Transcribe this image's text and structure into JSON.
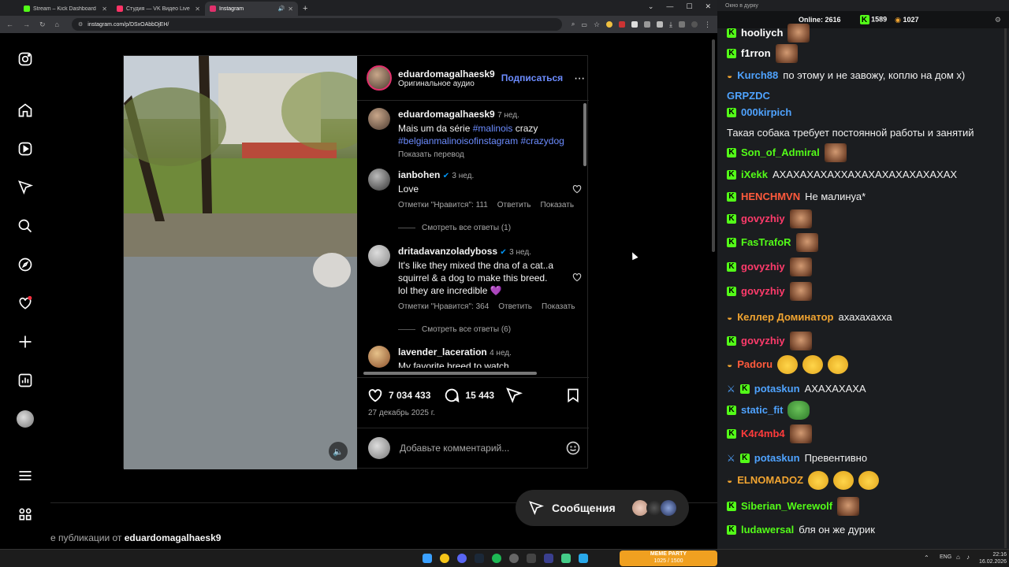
{
  "browser": {
    "tabs": [
      {
        "title": "Stream – Kick Dashboard",
        "color": "#53fc18",
        "active": false
      },
      {
        "title": "Студия — VK Видео Live",
        "color": "#ff3366",
        "active": false
      },
      {
        "title": "Instagram",
        "color": "#e1306c",
        "active": true
      }
    ],
    "url": "instagram.com/p/DSxOAbbDjEH/"
  },
  "post": {
    "author": "eduardomagalhaesk9",
    "audio": "Оригинальное аудио",
    "follow": "Подписаться",
    "caption": {
      "user": "eduardomagalhaesk9",
      "time": "7 нед.",
      "text": "Mais um da série",
      "tag1": "#malinois",
      "word": "crazy",
      "tag2": "#belgianmalinoisofinstagram",
      "tag3": "#crazydog",
      "translate": "Показать перевод"
    },
    "comments": [
      {
        "user": "ianbohen",
        "time": "3 нед.",
        "text": "Love",
        "likes": "Отметки \"Нравится\": 111",
        "reply": "Ответить",
        "show": "Показать",
        "replies": "Смотреть все ответы (1)"
      },
      {
        "user": "dritadavanzoladyboss",
        "time": "3 нед.",
        "text": "It's like they mixed the dna of a cat..a squirrel & a dog to make this breed. lol they are incredible 💜",
        "likes": "Отметки \"Нравится\": 364",
        "reply": "Ответить",
        "show": "Показать",
        "replies": "Смотреть все ответы (6)"
      },
      {
        "user": "lavender_laceration",
        "time": "4 нед.",
        "text": "My favorite breed to watch"
      }
    ],
    "like_count": "7 034 433",
    "comment_count": "15 443",
    "date": "27 декабрь 2025 г.",
    "comment_placeholder": "Добавьте комментарий...",
    "more_from": "е публикации от",
    "more_from_user": "eduardomagalhaesk9",
    "messages": "Сообщения"
  },
  "chat": {
    "title": "Окно в дурку",
    "online_label": "Online:",
    "online": "2616",
    "kick": "1589",
    "vk": "1027",
    "messages": [
      {
        "name": "hooliych",
        "color": "#ffffff",
        "badge": "kick",
        "text": "",
        "emote": true
      },
      {
        "name": "f1rron",
        "color": "#ffffff",
        "badge": "kick",
        "text": "",
        "emote": true
      },
      {
        "name": "Kurch88",
        "color": "#4fa3ff",
        "badge": "vk",
        "text": "по этому и не завожу, коплю на дом х)",
        "tail": "GRPZDC",
        "tail_color": "#4fa3ff"
      },
      {
        "name": "000kirpich",
        "color": "#4fa3ff",
        "badge": "kick",
        "text": "Такая собака требует постоянной работы и занятий"
      },
      {
        "name": "Son_of_Admiral",
        "color": "#53fc18",
        "badge": "kick",
        "text": "",
        "emote": true
      },
      {
        "name": "iXekk",
        "color": "#53fc18",
        "badge": "kick",
        "text": "АХАХАХАХАХХАХАХАХАХАХАХАХАХ"
      },
      {
        "name": "HENCHMVN",
        "color": "#ff5a3c",
        "badge": "kick",
        "text": "Не малинуа*"
      },
      {
        "name": "govyzhiy",
        "color": "#ff3b6b",
        "badge": "kick",
        "text": "",
        "emote": true
      },
      {
        "name": "FasTrafoR",
        "color": "#53fc18",
        "badge": "kick",
        "text": "",
        "emote": true
      },
      {
        "name": "govyzhiy",
        "color": "#ff3b6b",
        "badge": "kick",
        "text": "",
        "emote": true
      },
      {
        "name": "govyzhiy",
        "color": "#ff3b6b",
        "badge": "kick",
        "text": "",
        "emote": true
      },
      {
        "name": "Келлер Доминатор",
        "color": "#f2a531",
        "badge": "vk",
        "text": "ахахахахха"
      },
      {
        "name": "govyzhiy",
        "color": "#ff3b6b",
        "badge": "kick",
        "text": "",
        "emote": true
      },
      {
        "name": "Padoru",
        "color": "#ff5a3c",
        "badge": "vk",
        "text": "",
        "laugh": 3
      },
      {
        "name": "potaskun",
        "color": "#4fa3ff",
        "badge": "both",
        "text": "АХАХАХАХА"
      },
      {
        "name": "static_fit",
        "color": "#4fa3ff",
        "badge": "kick",
        "text": "",
        "pepe": true
      },
      {
        "name": "K4r4mb4",
        "color": "#ff3b3b",
        "badge": "kick",
        "text": "",
        "emote": true
      },
      {
        "name": "potaskun",
        "color": "#4fa3ff",
        "badge": "both",
        "text": "Превентивно"
      },
      {
        "name": "ELNOMADOZ",
        "color": "#f2a531",
        "badge": "vk",
        "text": "",
        "laugh": 3
      },
      {
        "name": "Siberian_Werewolf",
        "color": "#53fc18",
        "badge": "kick",
        "text": "",
        "emote": true
      },
      {
        "name": "ludawersal",
        "color": "#53fc18",
        "badge": "kick",
        "text": "бля он же дурик"
      }
    ]
  },
  "taskbar": {
    "lang": "ENG",
    "time": "22:16",
    "date": "16.02.2026",
    "widget": "MEME PARTY",
    "widget_count": "1025 / 1500"
  }
}
